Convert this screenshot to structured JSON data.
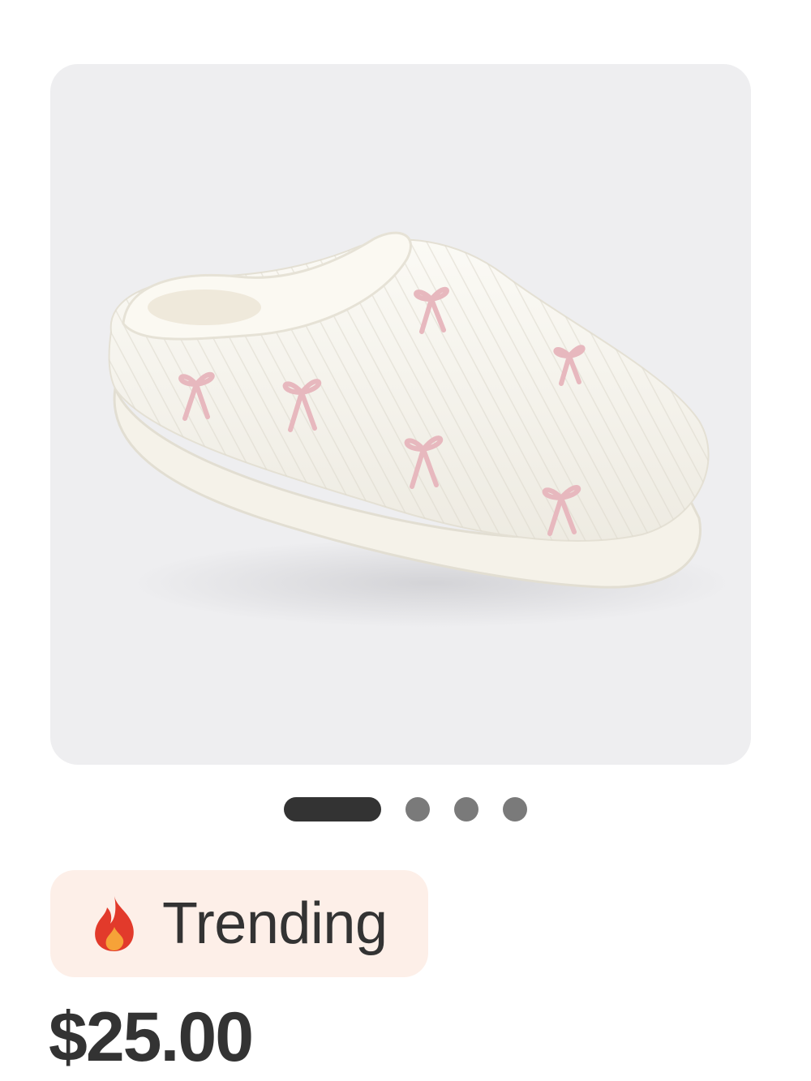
{
  "product": {
    "image_icon": "slipper-photo",
    "badge": {
      "icon": "fire-icon",
      "label": "Trending",
      "background": "#fdefe8"
    },
    "price": "$25.00"
  },
  "carousel": {
    "total_images": 4,
    "active_index": 0,
    "active_color": "#333333",
    "inactive_color": "#7a7a7a"
  }
}
